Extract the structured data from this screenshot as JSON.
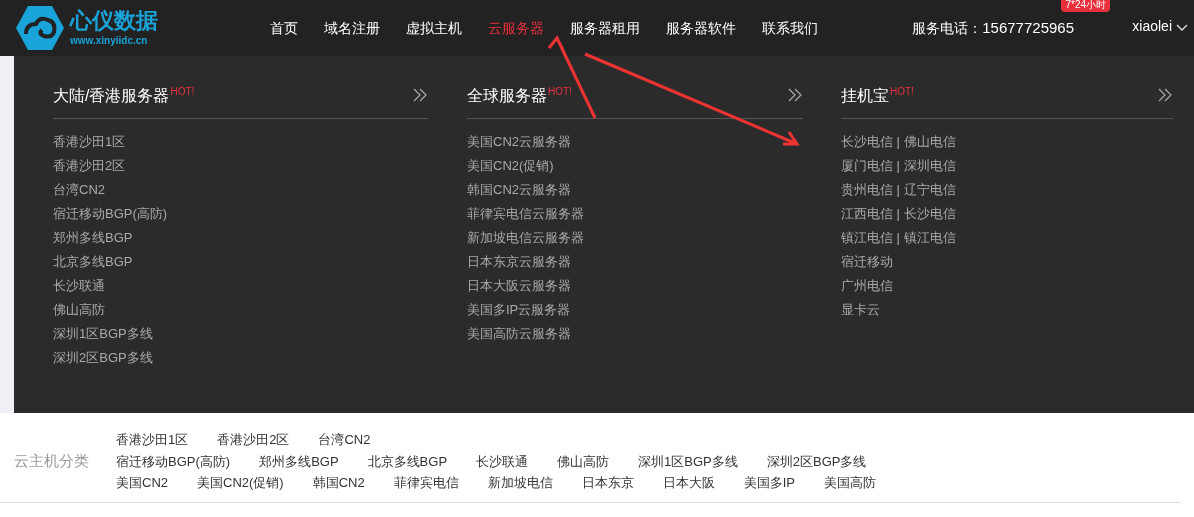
{
  "header": {
    "logo_name": "心仪数据",
    "logo_url": "www.xinyiidc.cn",
    "nav": [
      {
        "label": "首页",
        "selected": false
      },
      {
        "label": "域名注册",
        "selected": false
      },
      {
        "label": "虚拟主机",
        "selected": false
      },
      {
        "label": "云服务器",
        "selected": true
      },
      {
        "label": "服务器租用",
        "selected": false
      },
      {
        "label": "服务器软件",
        "selected": false
      },
      {
        "label": "联系我们",
        "selected": false
      }
    ],
    "phone_label": "服务电话：",
    "phone": "15677725965",
    "badge": "7*24小时",
    "user": "xiaolei"
  },
  "menu": {
    "columns": [
      {
        "title": "大陆/香港服务器",
        "tag": "HOT!",
        "items": [
          "香港沙田1区",
          "香港沙田2区",
          "台湾CN2",
          "宿迁移动BGP(高防)",
          "郑州多线BGP",
          "北京多线BGP",
          "长沙联通",
          "佛山高防",
          "深圳1区BGP多线",
          "深圳2区BGP多线"
        ]
      },
      {
        "title": "全球服务器",
        "tag": "HOT!",
        "items": [
          "美国CN2云服务器",
          "美国CN2(促销)",
          "韩国CN2云服务器",
          "菲律宾电信云服务器",
          "新加坡电信云服务器",
          "日本东京云服务器",
          "日本大阪云服务器",
          "美国多IP云服务器",
          "美国高防云服务器"
        ]
      },
      {
        "title": "挂机宝",
        "tag": "HOT!",
        "items": [
          "长沙电信 | 佛山电信",
          "厦门电信 | 深圳电信",
          "贵州电信 | 辽宁电信",
          "江西电信 | 长沙电信",
          "镇江电信 | 镇江电信",
          "宿迁移动",
          "广州电信",
          "显卡云"
        ]
      }
    ]
  },
  "categories": {
    "label": "云主机分类",
    "links": [
      "香港沙田1区",
      "香港沙田2区",
      "台湾CN2",
      "宿迁移动BGP(高防)",
      "郑州多线BGP",
      "北京多线BGP",
      "长沙联通",
      "佛山高防",
      "深圳1区BGP多线",
      "深圳2区BGP多线",
      "美国CN2",
      "美国CN2(促销)",
      "韩国CN2",
      "菲律宾电信",
      "新加坡电信",
      "日本东京",
      "日本大阪",
      "美国多IP",
      "美国高防"
    ]
  }
}
